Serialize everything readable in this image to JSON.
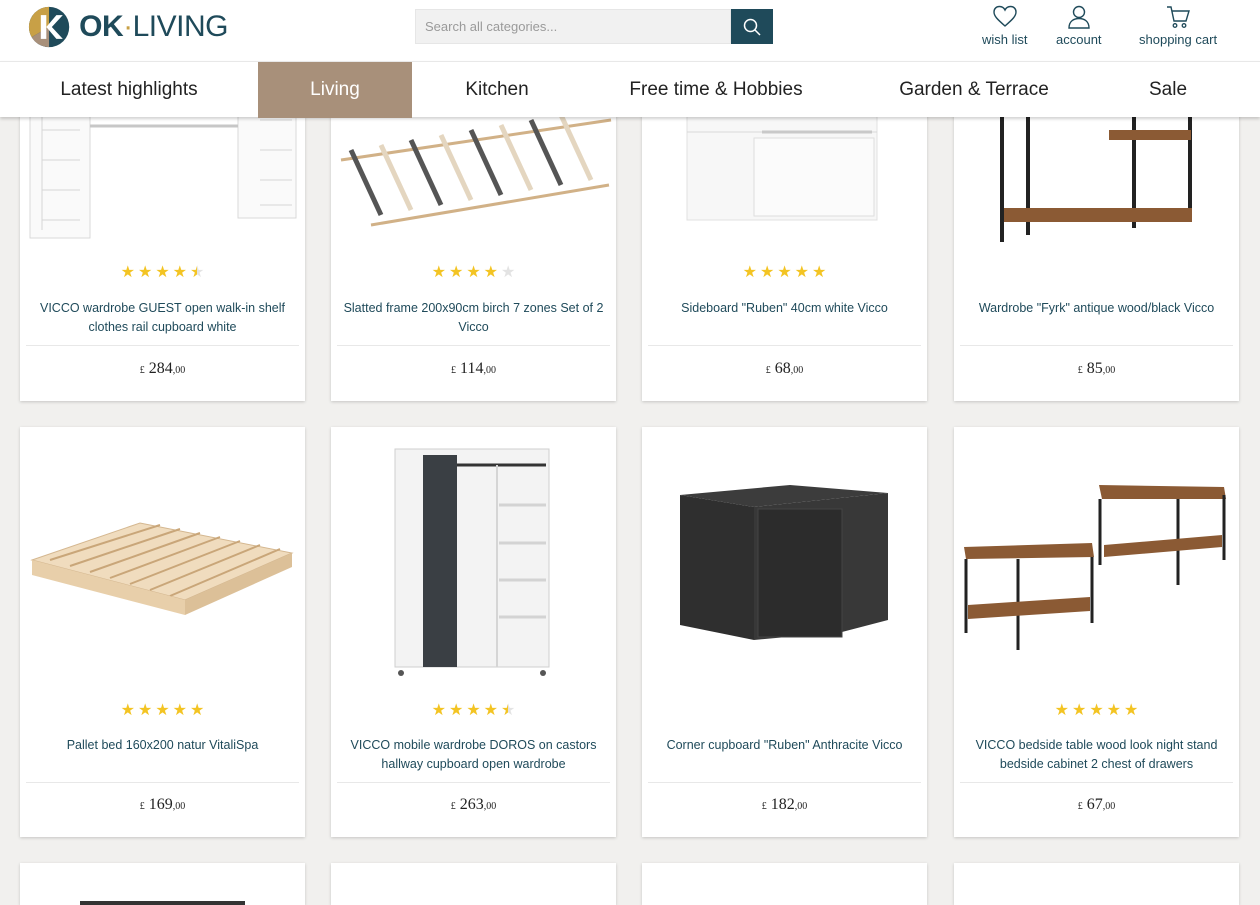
{
  "header": {
    "logo_text_bold": "OK",
    "logo_text_dot": "·",
    "logo_text_rest": "LIVING",
    "search_placeholder": "Search all categories...",
    "wishlist_label": "wish list",
    "account_label": "account",
    "cart_label": "shopping cart"
  },
  "nav": {
    "items": [
      "Latest highlights",
      "Living",
      "Kitchen",
      "Free time & Hobbies",
      "Garden & Terrace",
      "Sale"
    ],
    "active": "Living"
  },
  "colors": {
    "brand": "#1f4a5a",
    "nav_active": "#a8907a",
    "star": "#f3c423",
    "logo_gold": "#c8a046"
  },
  "products": [
    {
      "title": "VICCO wardrobe GUEST open walk-in shelf clothes rail cupboard white",
      "rating": 4.5,
      "currency": "£",
      "price": "284",
      "decimals": ",00",
      "image": "white-walk-in-shelf"
    },
    {
      "title": "Slatted frame 200x90cm birch 7 zones Set of 2 Vicco",
      "rating": 4,
      "currency": "£",
      "price": "114",
      "decimals": ",00",
      "image": "slatted-frame"
    },
    {
      "title": "Sideboard \"Ruben\" 40cm white Vicco",
      "rating": 5,
      "currency": "£",
      "price": "68",
      "decimals": ",00",
      "image": "white-sideboard"
    },
    {
      "title": "Wardrobe \"Fyrk\" antique wood/black Vicco",
      "rating": 0,
      "currency": "£",
      "price": "85",
      "decimals": ",00",
      "image": "metal-wood-rack"
    },
    {
      "title": "Pallet bed 160x200 natur VitaliSpa",
      "rating": 5,
      "currency": "£",
      "price": "169",
      "decimals": ",00",
      "image": "pallet-bed"
    },
    {
      "title": "VICCO mobile wardrobe DOROS on castors hallway cupboard open wardrobe",
      "rating": 4.5,
      "currency": "£",
      "price": "263",
      "decimals": ",00",
      "image": "mobile-wardrobe"
    },
    {
      "title": "Corner cupboard \"Ruben\" Anthracite Vicco",
      "rating": 0,
      "currency": "£",
      "price": "182",
      "decimals": ",00",
      "image": "anthracite-corner-cupboard"
    },
    {
      "title": "VICCO bedside table wood look night stand bedside cabinet 2 chest of drawers",
      "rating": 5,
      "currency": "£",
      "price": "67",
      "decimals": ",00",
      "image": "bedside-tables"
    }
  ]
}
